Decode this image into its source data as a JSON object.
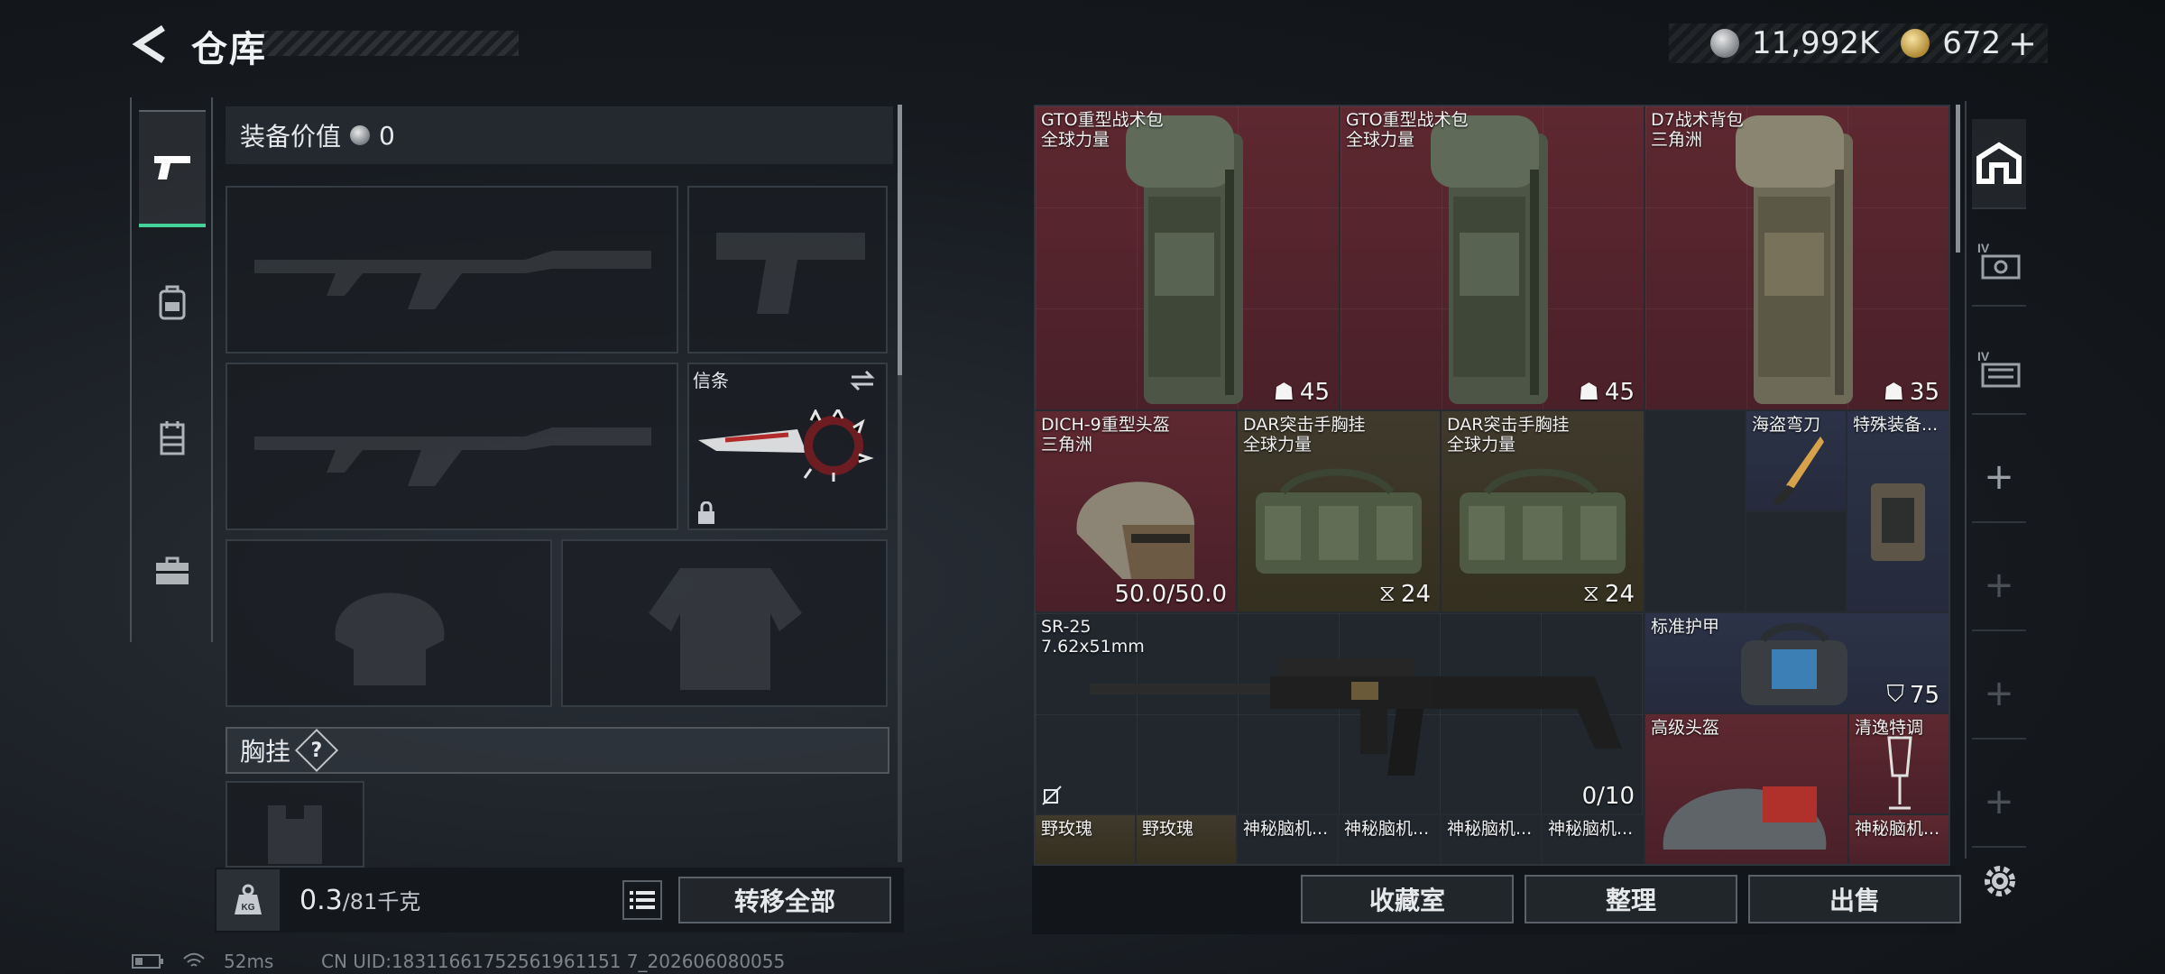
{
  "header": {
    "title": "仓库",
    "currency": [
      {
        "icon": "silver-coin-icon",
        "amount": "11,992K"
      },
      {
        "icon": "gold-coin-icon",
        "amount": "672",
        "suffix": "+"
      }
    ]
  },
  "left_tabs": [
    {
      "icon": "pistol-icon",
      "active": true
    },
    {
      "icon": "backpack-icon",
      "active": false
    },
    {
      "icon": "vest-icon",
      "active": false
    },
    {
      "icon": "toolbox-icon",
      "active": false
    }
  ],
  "equipment": {
    "value_label": "装备价值",
    "value": "0",
    "melee_label": "信条",
    "chest_label": "胸挂",
    "help_mark": "?"
  },
  "weight": {
    "badge": "KG",
    "current": "0.3",
    "max": "/81千克"
  },
  "buttons": {
    "transfer_all": "转移全部",
    "collection": "收藏室",
    "sort": "整理",
    "sell": "出售"
  },
  "stash_items": [
    {
      "name": "GTO重型战术包",
      "sub": "全球力量",
      "value": "45",
      "value_icon": "capacity-icon",
      "color": "red"
    },
    {
      "name": "GTO重型战术包",
      "sub": "全球力量",
      "value": "45",
      "value_icon": "capacity-icon",
      "color": "red"
    },
    {
      "name": "D7战术背包",
      "sub": "三角洲",
      "value": "35",
      "value_icon": "capacity-icon",
      "color": "red"
    },
    {
      "name": "DICH-9重型头盔",
      "sub": "三角洲",
      "value": "50.0/50.0",
      "color": "red"
    },
    {
      "name": "DAR突击手胸挂",
      "sub": "全球力量",
      "value": "24",
      "value_icon": "vest-capacity-icon",
      "color": "brown"
    },
    {
      "name": "DAR突击手胸挂",
      "sub": "全球力量",
      "value": "24",
      "value_icon": "vest-capacity-icon",
      "color": "brown"
    },
    {
      "name": "海盗弯刀",
      "sub": "",
      "value": "",
      "color": "navy"
    },
    {
      "name": "特殊装备...",
      "sub": "",
      "value": "",
      "color": "navy"
    },
    {
      "name": "SR-25",
      "sub": "7.62x51mm",
      "value": "0/10",
      "color": "dark"
    },
    {
      "name": "标准护甲",
      "sub": "",
      "value": "75",
      "value_icon": "armor-shield-icon",
      "color": "navy"
    },
    {
      "name": "高级头盔",
      "sub": "",
      "value": "",
      "color": "red"
    },
    {
      "name": "清逸特调",
      "sub": "",
      "value": "",
      "color": "red"
    },
    {
      "name": "野玫瑰",
      "color": "brown"
    },
    {
      "name": "野玫瑰",
      "color": "brown"
    },
    {
      "name": "神秘脑机...",
      "color": "dark"
    },
    {
      "name": "神秘脑机...",
      "color": "dark"
    },
    {
      "name": "神秘脑机...",
      "color": "dark"
    },
    {
      "name": "神秘脑机...",
      "color": "dark"
    },
    {
      "name": "神秘脑机...",
      "color": "red"
    }
  ],
  "right_tabs": [
    {
      "icon": "stash-home-icon",
      "active": true
    },
    {
      "icon": "stash-page-4-icon",
      "label": "IV"
    },
    {
      "icon": "stash-page-4b-icon",
      "label": "IV"
    },
    {
      "icon": "add-page-icon",
      "label": "+"
    },
    {
      "icon": "add-page-icon",
      "label": "+"
    },
    {
      "icon": "add-page-icon",
      "label": "+"
    },
    {
      "icon": "add-page-icon",
      "label": "+"
    }
  ],
  "status": {
    "ping": "52ms",
    "uid": "CN UID:18311661752561961151 7_202606080055"
  },
  "colors": {
    "accent": "#45d19a",
    "red_rarity": "#5e2830",
    "gold_rarity": "#3f3a2c",
    "purple_rarity": "#2c3348"
  }
}
